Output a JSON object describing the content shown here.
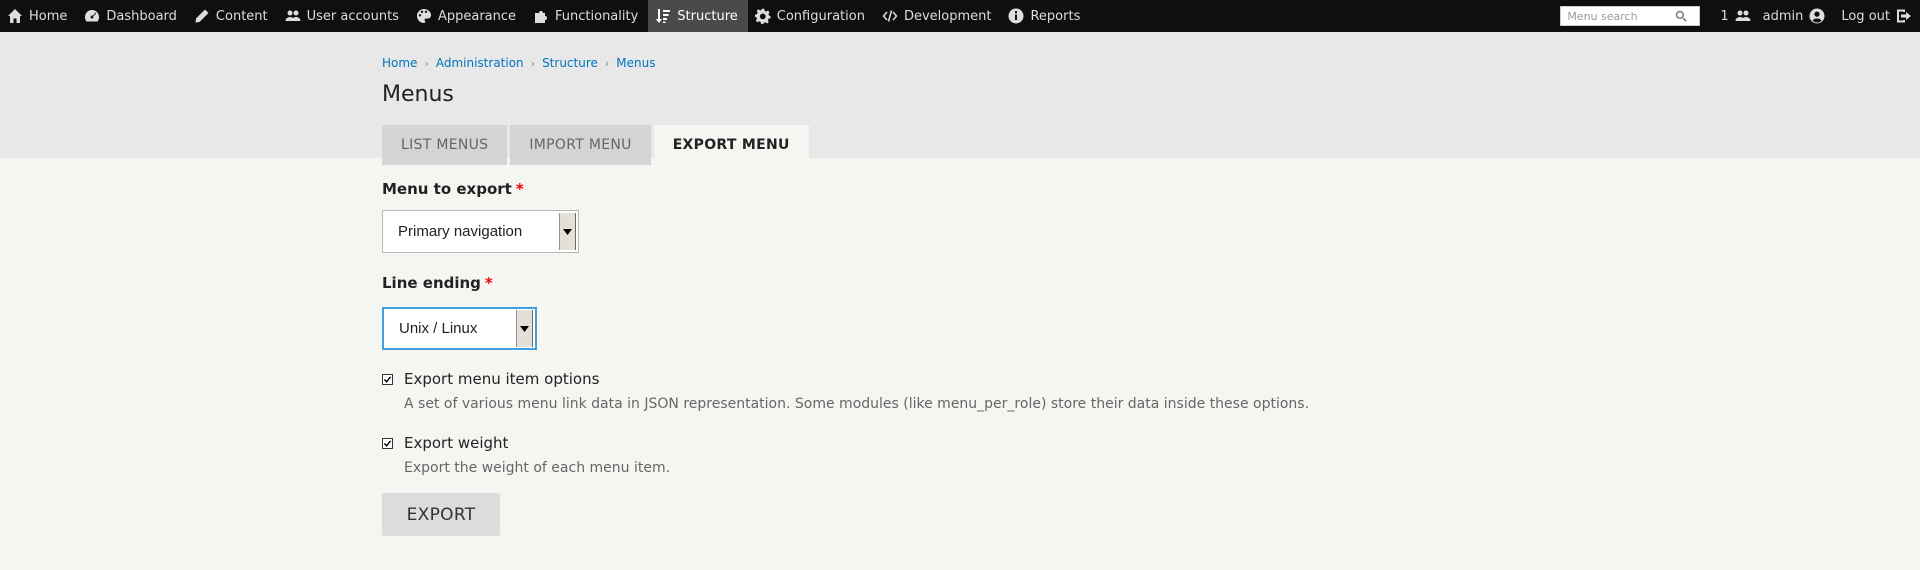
{
  "toolbar": {
    "items": [
      {
        "label": "Home",
        "icon": "home-icon"
      },
      {
        "label": "Dashboard",
        "icon": "dashboard-icon"
      },
      {
        "label": "Content",
        "icon": "pencil-icon"
      },
      {
        "label": "User accounts",
        "icon": "users-icon"
      },
      {
        "label": "Appearance",
        "icon": "palette-icon"
      },
      {
        "label": "Functionality",
        "icon": "puzzle-icon"
      },
      {
        "label": "Structure",
        "icon": "sort-icon",
        "active": true
      },
      {
        "label": "Configuration",
        "icon": "gear-icon"
      },
      {
        "label": "Development",
        "icon": "code-icon"
      },
      {
        "label": "Reports",
        "icon": "info-icon"
      }
    ],
    "search_placeholder": "Menu search",
    "user_count": "1",
    "username": "admin",
    "logout_label": "Log out"
  },
  "breadcrumb": [
    "Home",
    "Administration",
    "Structure",
    "Menus"
  ],
  "page_title": "Menus",
  "tabs": [
    {
      "label": "LIST MENUS",
      "active": false
    },
    {
      "label": "IMPORT MENU",
      "active": false
    },
    {
      "label": "EXPORT MENU",
      "active": true
    }
  ],
  "form": {
    "menu_label": "Menu to export",
    "menu_value": "Primary navigation",
    "line_ending_label": "Line ending",
    "line_ending_value": "Unix / Linux",
    "required_mark": "*",
    "opt_item_label": "Export menu item options",
    "opt_item_desc": "A set of various menu link data in JSON representation. Some modules (like menu_per_role) store their data inside these options.",
    "opt_item_checked": true,
    "opt_weight_label": "Export weight",
    "opt_weight_desc": "Export the weight of each menu item.",
    "opt_weight_checked": true,
    "submit_label": "EXPORT"
  },
  "colors": {
    "toolbar_bg": "#0f0f0f",
    "link": "#0074bd",
    "required": "#ee0000",
    "focus": "#40a0e0"
  }
}
